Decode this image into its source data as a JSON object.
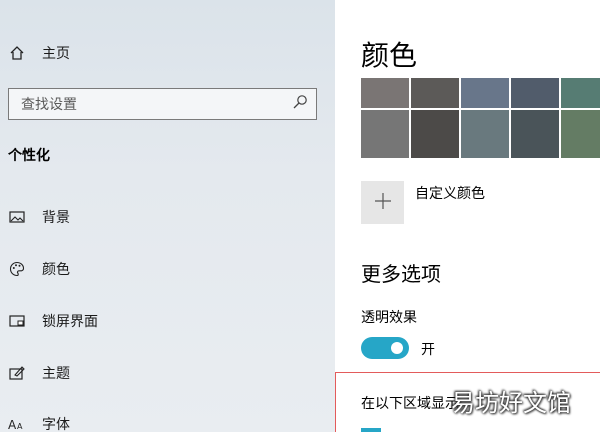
{
  "sidebar": {
    "home": {
      "label": "主页",
      "icon": "home-icon"
    },
    "search": {
      "placeholder": "查找设置",
      "icon": "search-icon"
    },
    "section_title": "个性化",
    "items": [
      {
        "label": "背景",
        "icon": "picture-icon"
      },
      {
        "label": "颜色",
        "icon": "palette-icon"
      },
      {
        "label": "锁屏界面",
        "icon": "lock-screen-icon"
      },
      {
        "label": "主题",
        "icon": "theme-edit-icon"
      },
      {
        "label": "字体",
        "icon": "font-icon"
      }
    ]
  },
  "main": {
    "title": "颜色",
    "swatches": [
      "#7a7574",
      "#5c5a58",
      "#68768a",
      "#515c6b",
      "#567c73",
      "#767676",
      "#4c4a48",
      "#69797e",
      "#4a5459",
      "#647c64"
    ],
    "custom_color_label": "自定义颜色",
    "more_options_title": "更多选项",
    "transparency": {
      "label": "透明效果",
      "state_text": "开",
      "on": true
    },
    "region_label": "在以下区域显示",
    "accent": "#26a6c7"
  },
  "watermark": "易坊好文馆"
}
